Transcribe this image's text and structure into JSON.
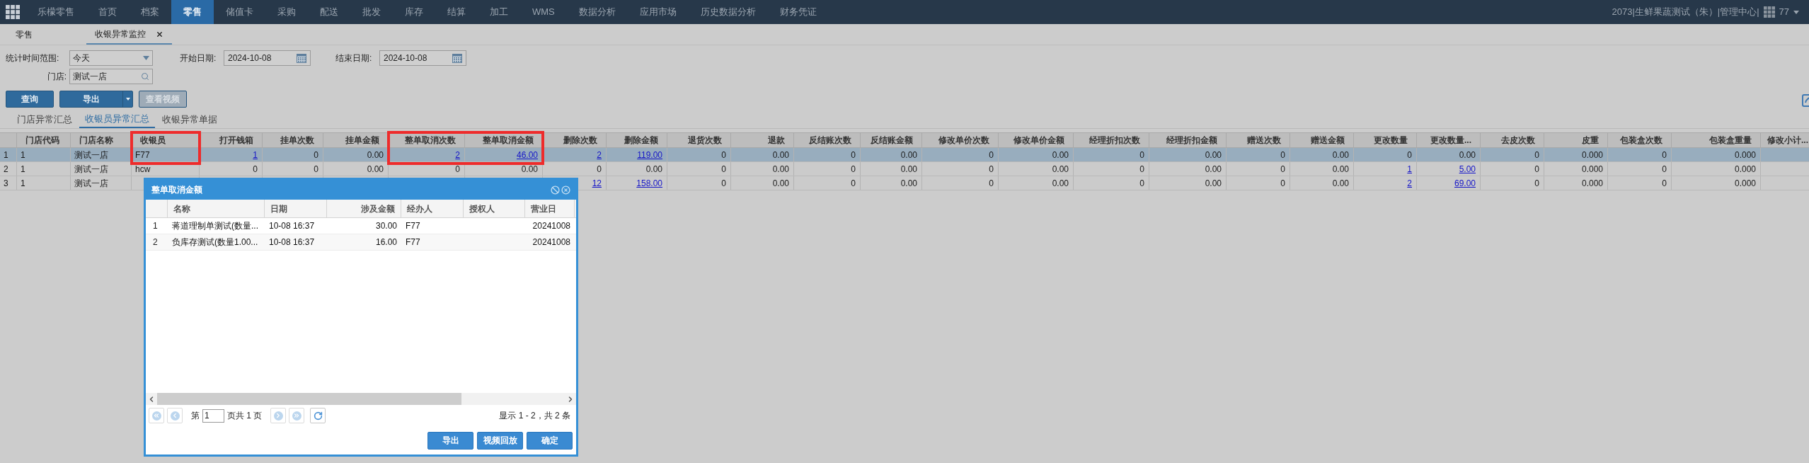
{
  "nav": {
    "items": [
      {
        "label": "乐檬零售",
        "selected": false
      },
      {
        "label": "首页",
        "selected": false
      },
      {
        "label": "档案",
        "selected": false
      },
      {
        "label": "零售",
        "selected": true
      },
      {
        "label": "储值卡",
        "selected": false
      },
      {
        "label": "采购",
        "selected": false
      },
      {
        "label": "配送",
        "selected": false
      },
      {
        "label": "批发",
        "selected": false
      },
      {
        "label": "库存",
        "selected": false
      },
      {
        "label": "结算",
        "selected": false
      },
      {
        "label": "加工",
        "selected": false
      },
      {
        "label": "WMS",
        "selected": false
      },
      {
        "label": "数据分析",
        "selected": false
      },
      {
        "label": "应用市场",
        "selected": false
      },
      {
        "label": "历史数据分析",
        "selected": false
      },
      {
        "label": "财务凭证",
        "selected": false
      }
    ],
    "account": "2073|生鲜果蔬测试（朱）|管理中心|",
    "user": "77"
  },
  "page_tabs": [
    {
      "label": "零售",
      "selected": false,
      "closable": false
    },
    {
      "label": "收银异常监控",
      "selected": true,
      "closable": true
    }
  ],
  "filters": {
    "range_label": "统计时间范围:",
    "range_value": "今天",
    "start_label": "开始日期:",
    "start_value": "2024-10-08",
    "end_label": "结束日期:",
    "end_value": "2024-10-08",
    "store_label": "门店:",
    "store_value": "测试一店"
  },
  "buttons": [
    {
      "label": "查询",
      "kind": "plain",
      "disabled": false
    },
    {
      "label": "导出",
      "kind": "split",
      "disabled": false
    },
    {
      "label": "查看视频",
      "kind": "plain",
      "disabled": true
    }
  ],
  "sub_tabs": [
    {
      "label": "门店异常汇总",
      "selected": false
    },
    {
      "label": "收银员异常汇总",
      "selected": true
    },
    {
      "label": "收银异常单据",
      "selected": false
    }
  ],
  "table": {
    "columns": [
      {
        "highlighted": false
      },
      {
        "label": "门店代码",
        "highlighted": false
      },
      {
        "label": "门店名称",
        "highlighted": false
      },
      {
        "label": "收银员",
        "highlighted": true
      },
      {
        "label": "打开钱箱",
        "highlighted": false
      },
      {
        "label": "挂单次数",
        "highlighted": false
      },
      {
        "label": "挂单金额",
        "highlighted": false
      },
      {
        "label": "整单取消次数",
        "highlighted": true
      },
      {
        "label": "整单取消金额",
        "highlighted": true
      },
      {
        "label": "删除次数",
        "highlighted": false
      },
      {
        "label": "删除金额",
        "highlighted": false
      },
      {
        "label": "退货次数",
        "highlighted": false
      },
      {
        "label": "退款",
        "highlighted": false
      },
      {
        "label": "反结账次数",
        "highlighted": false
      },
      {
        "label": "反结账金额",
        "highlighted": false
      },
      {
        "label": "修改单价次数",
        "highlighted": false
      },
      {
        "label": "修改单价金额",
        "highlighted": false
      },
      {
        "label": "经理折扣次数",
        "highlighted": false
      },
      {
        "label": "经理折扣金额",
        "highlighted": false
      },
      {
        "label": "赠送次数",
        "highlighted": false
      },
      {
        "label": "赠送金额",
        "highlighted": false
      },
      {
        "label": "更改数量",
        "highlighted": false
      },
      {
        "label": "更改数量...",
        "highlighted": false
      },
      {
        "label": "去皮次数",
        "highlighted": false
      },
      {
        "label": "皮重",
        "highlighted": false
      },
      {
        "label": "包装盒次数",
        "highlighted": false
      },
      {
        "label": "包装盒重量",
        "highlighted": false
      },
      {
        "label": "修改小计...",
        "highlighted": false
      }
    ],
    "rows": [
      {
        "selected": true,
        "cells": [
          "1",
          "1",
          "测试一店",
          "F77",
          {
            "text": "1",
            "link": true
          },
          "0",
          "0.00",
          {
            "text": "2",
            "link": true
          },
          {
            "text": "46.00",
            "link": true
          },
          {
            "text": "2",
            "link": true
          },
          {
            "text": "119.00",
            "link": true
          },
          "0",
          "0.00",
          "0",
          "0.00",
          "0",
          "0.00",
          "0",
          "0.00",
          "0",
          "0.00",
          "0",
          "0.00",
          "0",
          "0.000",
          "0",
          "0.000"
        ]
      },
      {
        "selected": false,
        "cells": [
          "2",
          "1",
          "测试一店",
          "hcw",
          "0",
          "0",
          "0.00",
          "0",
          "0.00",
          "0",
          "0.00",
          "0",
          "0.00",
          "0",
          "0.00",
          "0",
          "0.00",
          "0",
          "0.00",
          "0",
          "0.00",
          {
            "text": "1",
            "link": true
          },
          {
            "text": "5.00",
            "link": true
          },
          "0",
          "0.000",
          "0",
          "0.000"
        ]
      },
      {
        "selected": false,
        "cells": [
          "3",
          "1",
          "测试一店",
          null,
          null,
          null,
          null,
          null,
          null,
          {
            "text": "12",
            "link": true
          },
          {
            "text": "158.00",
            "link": true
          },
          "0",
          "0.00",
          "0",
          "0.00",
          "0",
          "0.00",
          "0",
          "0.00",
          "0",
          "0.00",
          {
            "text": "2",
            "link": true
          },
          {
            "text": "69.00",
            "link": true
          },
          "0",
          "0.000",
          "0",
          "0.000"
        ]
      }
    ]
  },
  "dialog": {
    "title": "整单取消金额",
    "columns": [
      "名称",
      "日期",
      "涉及金额",
      "经办人",
      "授权人",
      "营业日"
    ],
    "rows": [
      {
        "number": "1",
        "cells": [
          "蒋道理制单测试(数量...",
          "10-08 16:37",
          "30.00",
          "F77",
          null,
          "20241008"
        ]
      },
      {
        "number": "2",
        "cells": [
          "负库存测试(数量1.00...",
          "10-08 16:37",
          "16.00",
          "F77",
          null,
          "20241008"
        ]
      }
    ],
    "pager": {
      "prefix": "第",
      "page": "1",
      "suffix": "页共 1 页",
      "summary": "显示 1 - 2，共 2 条"
    },
    "buttons": [
      "导出",
      "视频回放",
      "确定"
    ]
  }
}
